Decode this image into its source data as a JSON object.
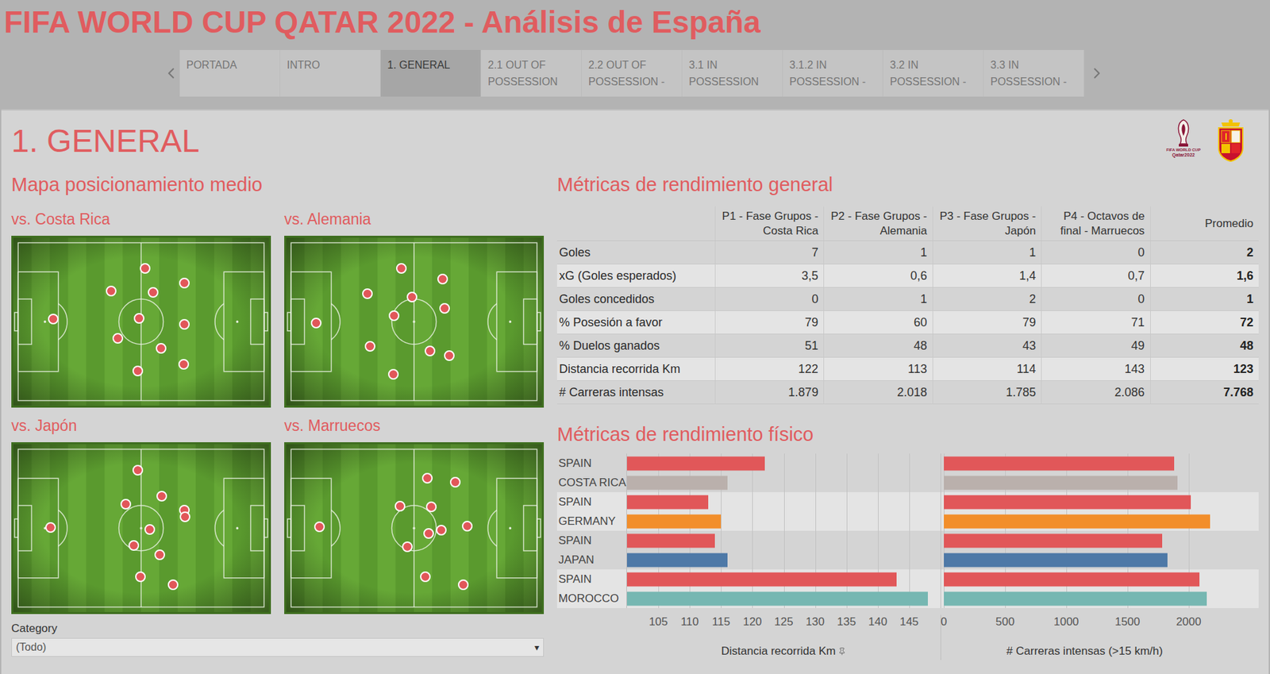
{
  "header": {
    "title": "FIFA WORLD CUP QATAR 2022 - Análisis de España"
  },
  "tabs": [
    {
      "label": "PORTADA",
      "selected": false
    },
    {
      "label": "INTRO",
      "selected": false
    },
    {
      "label": "1. GENERAL",
      "selected": true
    },
    {
      "label": "2.1 OUT OF POSSESSION",
      "selected": false
    },
    {
      "label": "2.2 OUT OF POSSESSION -",
      "selected": false
    },
    {
      "label": "3.1 IN POSSESSION",
      "selected": false
    },
    {
      "label": "3.1.2 IN POSSESSION -",
      "selected": false
    },
    {
      "label": "3.2 IN POSSESSION -",
      "selected": false
    },
    {
      "label": "3.3 IN POSSESSION -",
      "selected": false
    }
  ],
  "page": {
    "title": "1. GENERAL"
  },
  "logos": {
    "fifa_line1": "FIFA WORLD CUP",
    "fifa_line2": "Qatar2022"
  },
  "maps": {
    "title": "Mapa posicionamiento medio",
    "matches": [
      {
        "title": "vs. Costa Rica",
        "players": [
          {
            "x": 15.7,
            "y": 48.4
          },
          {
            "x": 38.4,
            "y": 31.6
          },
          {
            "x": 51.6,
            "y": 18.1
          },
          {
            "x": 54.7,
            "y": 32.6
          },
          {
            "x": 67.0,
            "y": 27.0
          },
          {
            "x": 49.1,
            "y": 47.9
          },
          {
            "x": 67.0,
            "y": 51.6
          },
          {
            "x": 40.9,
            "y": 60.0
          },
          {
            "x": 57.9,
            "y": 66.0
          },
          {
            "x": 48.7,
            "y": 79.5
          },
          {
            "x": 66.7,
            "y": 75.3
          }
        ]
      },
      {
        "title": "vs. Alemania",
        "players": [
          {
            "x": 11.6,
            "y": 50.7
          },
          {
            "x": 31.8,
            "y": 33.5
          },
          {
            "x": 45.0,
            "y": 18.1
          },
          {
            "x": 49.1,
            "y": 35.3
          },
          {
            "x": 61.3,
            "y": 24.7
          },
          {
            "x": 42.1,
            "y": 46.5
          },
          {
            "x": 61.9,
            "y": 41.9
          },
          {
            "x": 32.7,
            "y": 64.7
          },
          {
            "x": 56.3,
            "y": 67.4
          },
          {
            "x": 63.8,
            "y": 70.2
          },
          {
            "x": 41.8,
            "y": 81.4
          }
        ]
      },
      {
        "title": "vs. Japón",
        "players": [
          {
            "x": 14.5,
            "y": 49.8
          },
          {
            "x": 48.7,
            "y": 15.3
          },
          {
            "x": 43.9,
            "y": 35.9
          },
          {
            "x": 58.1,
            "y": 31.1
          },
          {
            "x": 66.8,
            "y": 39.2
          },
          {
            "x": 67.1,
            "y": 43.1
          },
          {
            "x": 53.5,
            "y": 50.7
          },
          {
            "x": 47.1,
            "y": 60.3
          },
          {
            "x": 57.4,
            "y": 66.0
          },
          {
            "x": 49.7,
            "y": 78.9
          },
          {
            "x": 62.6,
            "y": 83.7
          }
        ]
      },
      {
        "title": "vs. Marruecos",
        "players": [
          {
            "x": 13.0,
            "y": 49.3
          },
          {
            "x": 55.2,
            "y": 20.1
          },
          {
            "x": 66.2,
            "y": 22.5
          },
          {
            "x": 44.5,
            "y": 36.8
          },
          {
            "x": 56.8,
            "y": 37.3
          },
          {
            "x": 60.7,
            "y": 51.2
          },
          {
            "x": 55.8,
            "y": 53.1
          },
          {
            "x": 70.8,
            "y": 48.8
          },
          {
            "x": 47.4,
            "y": 61.2
          },
          {
            "x": 54.5,
            "y": 78.9
          },
          {
            "x": 69.2,
            "y": 83.7
          }
        ]
      }
    ]
  },
  "filter": {
    "label": "Category",
    "value": "(Todo)",
    "arrow": "▾"
  },
  "general": {
    "title": "Métricas de rendimiento general",
    "columns": [
      {
        "lines": [
          "P1 - Fase Grupos -",
          "Costa Rica"
        ]
      },
      {
        "lines": [
          "P2 - Fase Grupos -",
          "Alemania"
        ]
      },
      {
        "lines": [
          "P3 - Fase Grupos -",
          "Japón"
        ]
      },
      {
        "lines": [
          "P4 - Octavos de",
          "final - Marruecos"
        ]
      },
      {
        "lines": [
          "Promedio"
        ]
      }
    ],
    "rows": [
      {
        "label": "Goles",
        "values": [
          "7",
          "1",
          "1",
          "0"
        ],
        "average": "2"
      },
      {
        "label": "xG (Goles esperados)",
        "values": [
          "3,5",
          "0,6",
          "1,4",
          "0,7"
        ],
        "average": "1,6"
      },
      {
        "label": "Goles concedidos",
        "values": [
          "0",
          "1",
          "2",
          "0"
        ],
        "average": "1"
      },
      {
        "label": "% Posesión a favor",
        "values": [
          "79",
          "60",
          "79",
          "71"
        ],
        "average": "72"
      },
      {
        "label": "% Duelos ganados",
        "values": [
          "51",
          "48",
          "43",
          "49"
        ],
        "average": "48"
      },
      {
        "label": "Distancia recorrida Km",
        "values": [
          "122",
          "113",
          "114",
          "143"
        ],
        "average": "123"
      },
      {
        "label": "# Carreras intensas",
        "values": [
          "1.879",
          "2.018",
          "1.785",
          "2.086"
        ],
        "average": "7.768"
      }
    ]
  },
  "physical": {
    "title": "Métricas de rendimiento físico",
    "teams": [
      {
        "name": "SPAIN",
        "color": "#e15759",
        "distance": 122,
        "runs": 1879,
        "band": false
      },
      {
        "name": "COSTA RICA",
        "color": "#bab0ac",
        "distance": 116,
        "runs": 1907,
        "band": false
      },
      {
        "name": "SPAIN",
        "color": "#e15759",
        "distance": 113,
        "runs": 2018,
        "band": true
      },
      {
        "name": "GERMANY",
        "color": "#f28e2b",
        "distance": 115,
        "runs": 2175,
        "band": true
      },
      {
        "name": "SPAIN",
        "color": "#e15759",
        "distance": 114,
        "runs": 1785,
        "band": false
      },
      {
        "name": "JAPAN",
        "color": "#4e79a7",
        "distance": 116,
        "runs": 1826,
        "band": false
      },
      {
        "name": "SPAIN",
        "color": "#e15759",
        "distance": 143,
        "runs": 2086,
        "band": true
      },
      {
        "name": "MOROCCO",
        "color": "#76b7b2",
        "distance": 148,
        "runs": 2146,
        "band": true
      }
    ],
    "distance_axis": {
      "min": 100,
      "max": 150,
      "ticks": [
        "105",
        "110",
        "115",
        "120",
        "125",
        "130",
        "135",
        "140",
        "145"
      ],
      "title": "Distancia recorrida Km"
    },
    "runs_axis": {
      "min": 0,
      "max": 2300,
      "ticks": [
        "0",
        "500",
        "1000",
        "1500",
        "2000"
      ],
      "title": "# Carreras intensas (>15 km/h)"
    }
  }
}
